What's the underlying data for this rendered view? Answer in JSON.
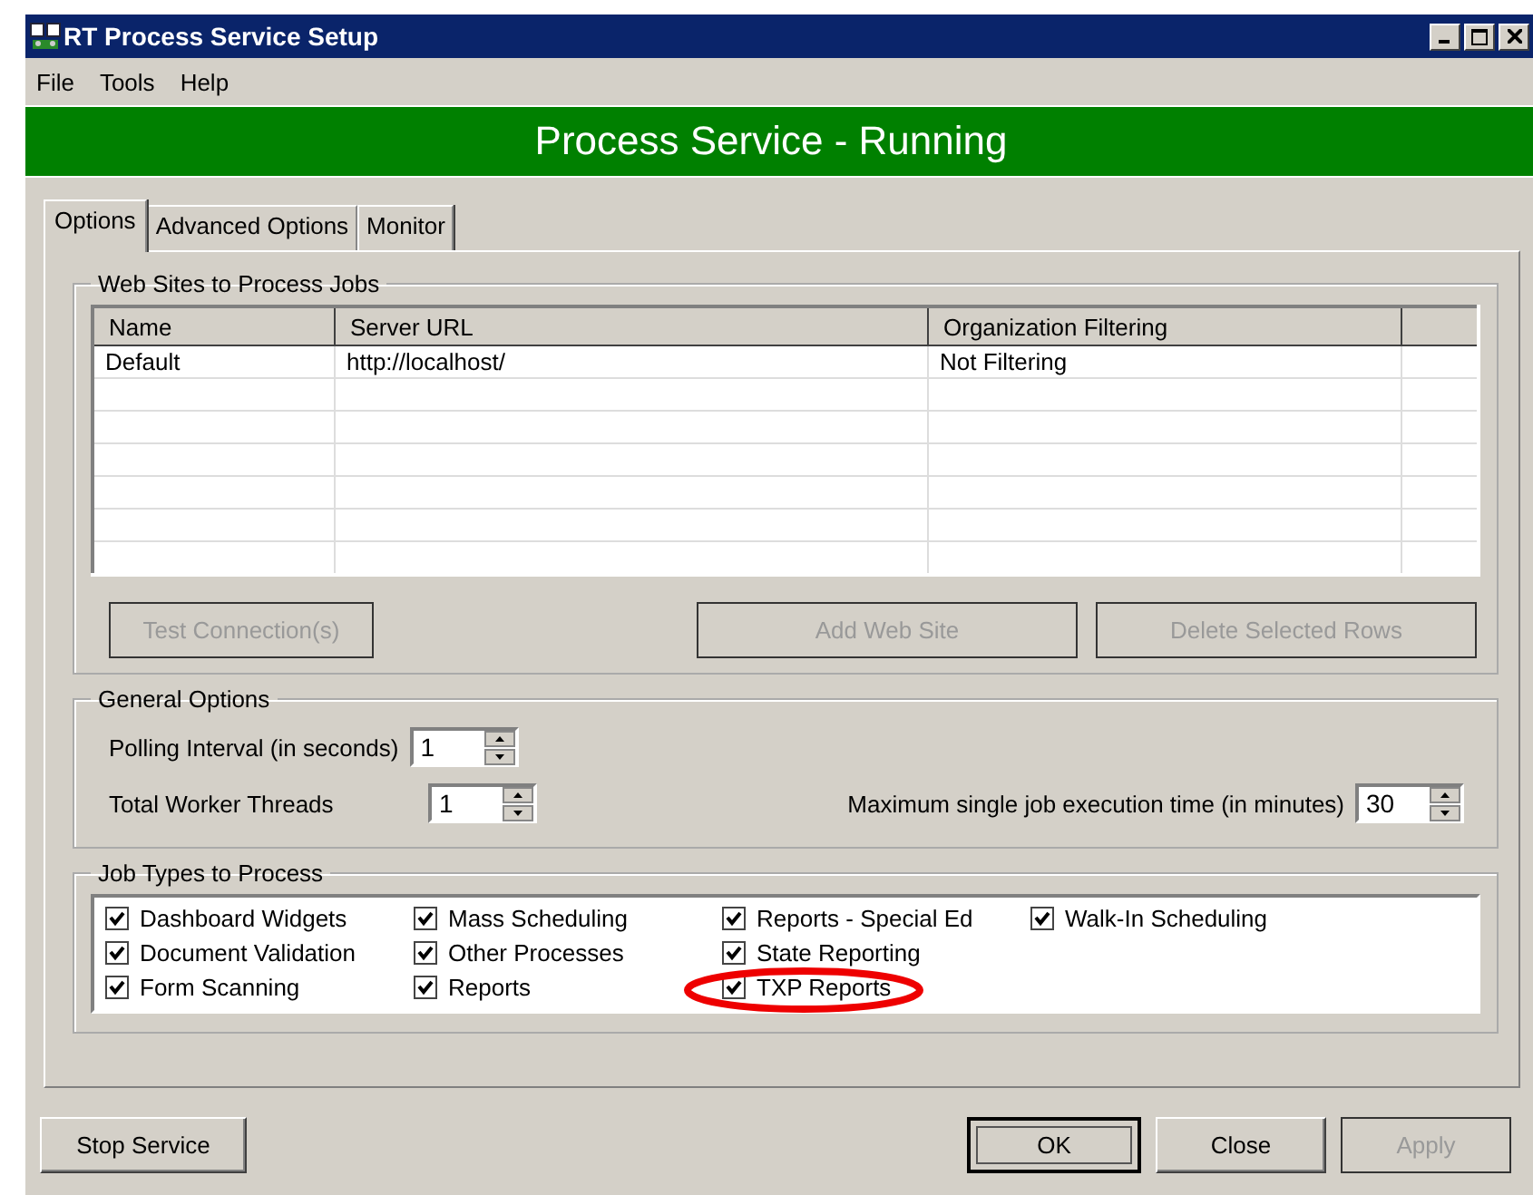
{
  "window": {
    "title": "RT Process Service Setup"
  },
  "menu": [
    "File",
    "Tools",
    "Help"
  ],
  "banner": "Process Service - Running",
  "tabs": [
    {
      "label": "Options",
      "selected": true
    },
    {
      "label": "Advanced Options",
      "selected": false
    },
    {
      "label": "Monitor",
      "selected": false
    }
  ],
  "web_sites": {
    "title": "Web Sites to Process Jobs",
    "columns": [
      "Name",
      "Server URL",
      "Organization Filtering"
    ],
    "rows": [
      [
        "Default",
        "http://localhost/",
        "Not Filtering"
      ]
    ],
    "buttons": [
      {
        "label": "Test Connection(s)",
        "disabled": true
      },
      {
        "label": "Add Web Site",
        "disabled": true
      },
      {
        "label": "Delete Selected Rows",
        "disabled": true
      }
    ]
  },
  "general_options": {
    "title": "General Options",
    "fields": [
      {
        "label": "Polling Interval (in seconds)",
        "value": "1"
      },
      {
        "label": "Total Worker Threads",
        "value": "1"
      },
      {
        "label": "Maximum  single  job  execution  time  (in minutes)",
        "value": "30"
      }
    ]
  },
  "job_types": {
    "title": "Job Types to Process",
    "items": [
      {
        "label": "Dashboard Widgets",
        "checked": true,
        "highlighted": false
      },
      {
        "label": "Document Validation",
        "checked": true,
        "highlighted": false
      },
      {
        "label": "Form Scanning",
        "checked": true,
        "highlighted": false
      },
      {
        "label": "Mass Scheduling",
        "checked": true,
        "highlighted": false
      },
      {
        "label": "Other Processes",
        "checked": true,
        "highlighted": false
      },
      {
        "label": "Reports",
        "checked": true,
        "highlighted": false
      },
      {
        "label": "Reports - Special Ed",
        "checked": true,
        "highlighted": false
      },
      {
        "label": "State Reporting",
        "checked": true,
        "highlighted": false
      },
      {
        "label": "TXP Reports",
        "checked": true,
        "highlighted": true
      },
      {
        "label": "Walk-In Scheduling",
        "checked": true,
        "highlighted": false
      }
    ]
  },
  "buttons": [
    {
      "label": "Stop Service",
      "disabled": false,
      "default": false
    },
    {
      "label": "OK",
      "disabled": false,
      "default": true
    },
    {
      "label": "Close",
      "disabled": false,
      "default": false
    },
    {
      "label": "Apply",
      "disabled": true,
      "default": false
    }
  ]
}
